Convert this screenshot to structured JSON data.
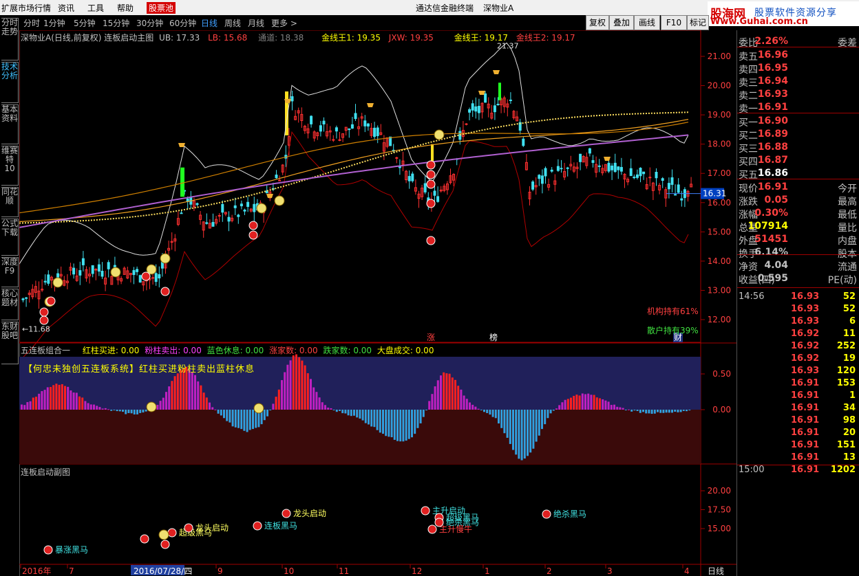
{
  "menu": {
    "items": [
      "扩展市场行情",
      "资讯",
      "工具",
      "帮助",
      "股票池"
    ],
    "center_title": "通达信金融终端",
    "stock_name": "深物业A"
  },
  "logo": {
    "main": "股海网",
    "sub": "股票软件资源分享",
    "url": "Www.Guhai.com.cn"
  },
  "left_tabs": [
    "分时走势",
    "技术分析",
    "基本资料",
    "维赛特10",
    "同花顺",
    "公式下载",
    "深度F9",
    "核心题材",
    "东财股吧"
  ],
  "periods": [
    "分时",
    "1分钟",
    "5分钟",
    "15分钟",
    "30分钟",
    "60分钟",
    "日线",
    "周线",
    "月线",
    "更多 >"
  ],
  "active_period": "日线",
  "toolbar_buttons": [
    "复权",
    "叠加",
    "画线",
    "F10",
    "标记"
  ],
  "info_line": {
    "title": "深物业A(日线,前复权) 连板启动主图",
    "ub": "UB: 17.33",
    "lb": "LB: 15.68",
    "channel": "通道: 18.38",
    "jxw1": "金线王1: 19.35",
    "jxw": "JXW: 19.35",
    "jxw_main": "金线王: 19.17",
    "jxw2": "金线王2: 19.17"
  },
  "main_axis": [
    "21.00",
    "20.00",
    "19.00",
    "18.00",
    "17.00",
    "16.00",
    "15.00",
    "14.00",
    "13.00",
    "12.00"
  ],
  "price_marks": {
    "high": "21.37",
    "low": "11.68",
    "current_tag": "16.31"
  },
  "holdings": {
    "inst": "机构持有61%",
    "retail": "散户持有39%"
  },
  "event_marks": [
    "涨",
    "榜",
    "财"
  ],
  "sub1": {
    "title": "五连板组合一",
    "red": "红柱买进: 0.00",
    "pink": "粉柱卖出: 0.00",
    "blue": "蓝色休息: 0.00",
    "up": "涨家数: 0.00",
    "down": "跌家数: 0.00",
    "market": "大盘成交: 0.00",
    "banner": "【何忠未独创五连板系统】红柱买进粉柱卖出蓝柱休息",
    "axis": [
      "0.50",
      "0.00"
    ]
  },
  "sub2": {
    "title": "连板启动副图",
    "axis": [
      "20.00",
      "17.50",
      "15.00"
    ],
    "labels": [
      "龙头启动",
      "主升启动",
      "超级黑马",
      "绝杀黑马",
      "主升慢牛",
      "龙头启动",
      "超级黑马",
      "绝杀黑马",
      "连板黑马",
      "暴涨黑马"
    ]
  },
  "dates": [
    "2016年",
    "7",
    "2016/07/28/四",
    "9",
    "10",
    "11",
    "12",
    "1",
    "2",
    "3",
    "4"
  ],
  "date_period": "日线",
  "quote": {
    "wei_label": "委比",
    "wei_val": "2.26%",
    "wei_diff_label": "委差",
    "asks": [
      {
        "label": "卖五",
        "price": "16.96"
      },
      {
        "label": "卖四",
        "price": "16.95"
      },
      {
        "label": "卖三",
        "price": "16.94"
      },
      {
        "label": "卖二",
        "price": "16.93"
      },
      {
        "label": "卖一",
        "price": "16.91"
      }
    ],
    "bids": [
      {
        "label": "买一",
        "price": "16.90"
      },
      {
        "label": "买二",
        "price": "16.89"
      },
      {
        "label": "买三",
        "price": "16.88"
      },
      {
        "label": "买四",
        "price": "16.87"
      },
      {
        "label": "买五",
        "price": "16.86"
      }
    ],
    "stats": [
      {
        "l": "现价",
        "v": "16.91",
        "r": "今开"
      },
      {
        "l": "涨跌",
        "v": "0.05",
        "r": "最高"
      },
      {
        "l": "涨幅",
        "v": "0.30%",
        "r": "最低"
      },
      {
        "l": "总量",
        "v": "107914",
        "r": "量比"
      },
      {
        "l": "外盘",
        "v": "51451",
        "r": "内盘"
      },
      {
        "l": "换手",
        "v": "6.14%",
        "r": "股本"
      },
      {
        "l": "净资",
        "v": "4.04",
        "r": "流通"
      },
      {
        "l": "收益(四)",
        "v": "0.595",
        "r": "PE(动)"
      }
    ],
    "ticks": [
      {
        "t": "14:56",
        "p": "16.93",
        "v": "52"
      },
      {
        "t": "",
        "p": "16.93",
        "v": "52"
      },
      {
        "t": "",
        "p": "16.93",
        "v": "6"
      },
      {
        "t": "",
        "p": "16.92",
        "v": "11"
      },
      {
        "t": "",
        "p": "16.92",
        "v": "252"
      },
      {
        "t": "",
        "p": "16.92",
        "v": "19"
      },
      {
        "t": "",
        "p": "16.93",
        "v": "120"
      },
      {
        "t": "",
        "p": "16.91",
        "v": "153"
      },
      {
        "t": "",
        "p": "16.91",
        "v": "1"
      },
      {
        "t": "",
        "p": "16.91",
        "v": "34"
      },
      {
        "t": "",
        "p": "16.91",
        "v": "98"
      },
      {
        "t": "",
        "p": "16.91",
        "v": "20"
      },
      {
        "t": "",
        "p": "16.91",
        "v": "151"
      },
      {
        "t": "",
        "p": "16.91",
        "v": "13"
      }
    ],
    "close": {
      "t": "15:00",
      "p": "16.91",
      "v": "1202"
    }
  },
  "colors": {
    "up": "#ff3030",
    "down": "#40e0f0",
    "gold": "#f0a020",
    "axis": "#a00000"
  }
}
